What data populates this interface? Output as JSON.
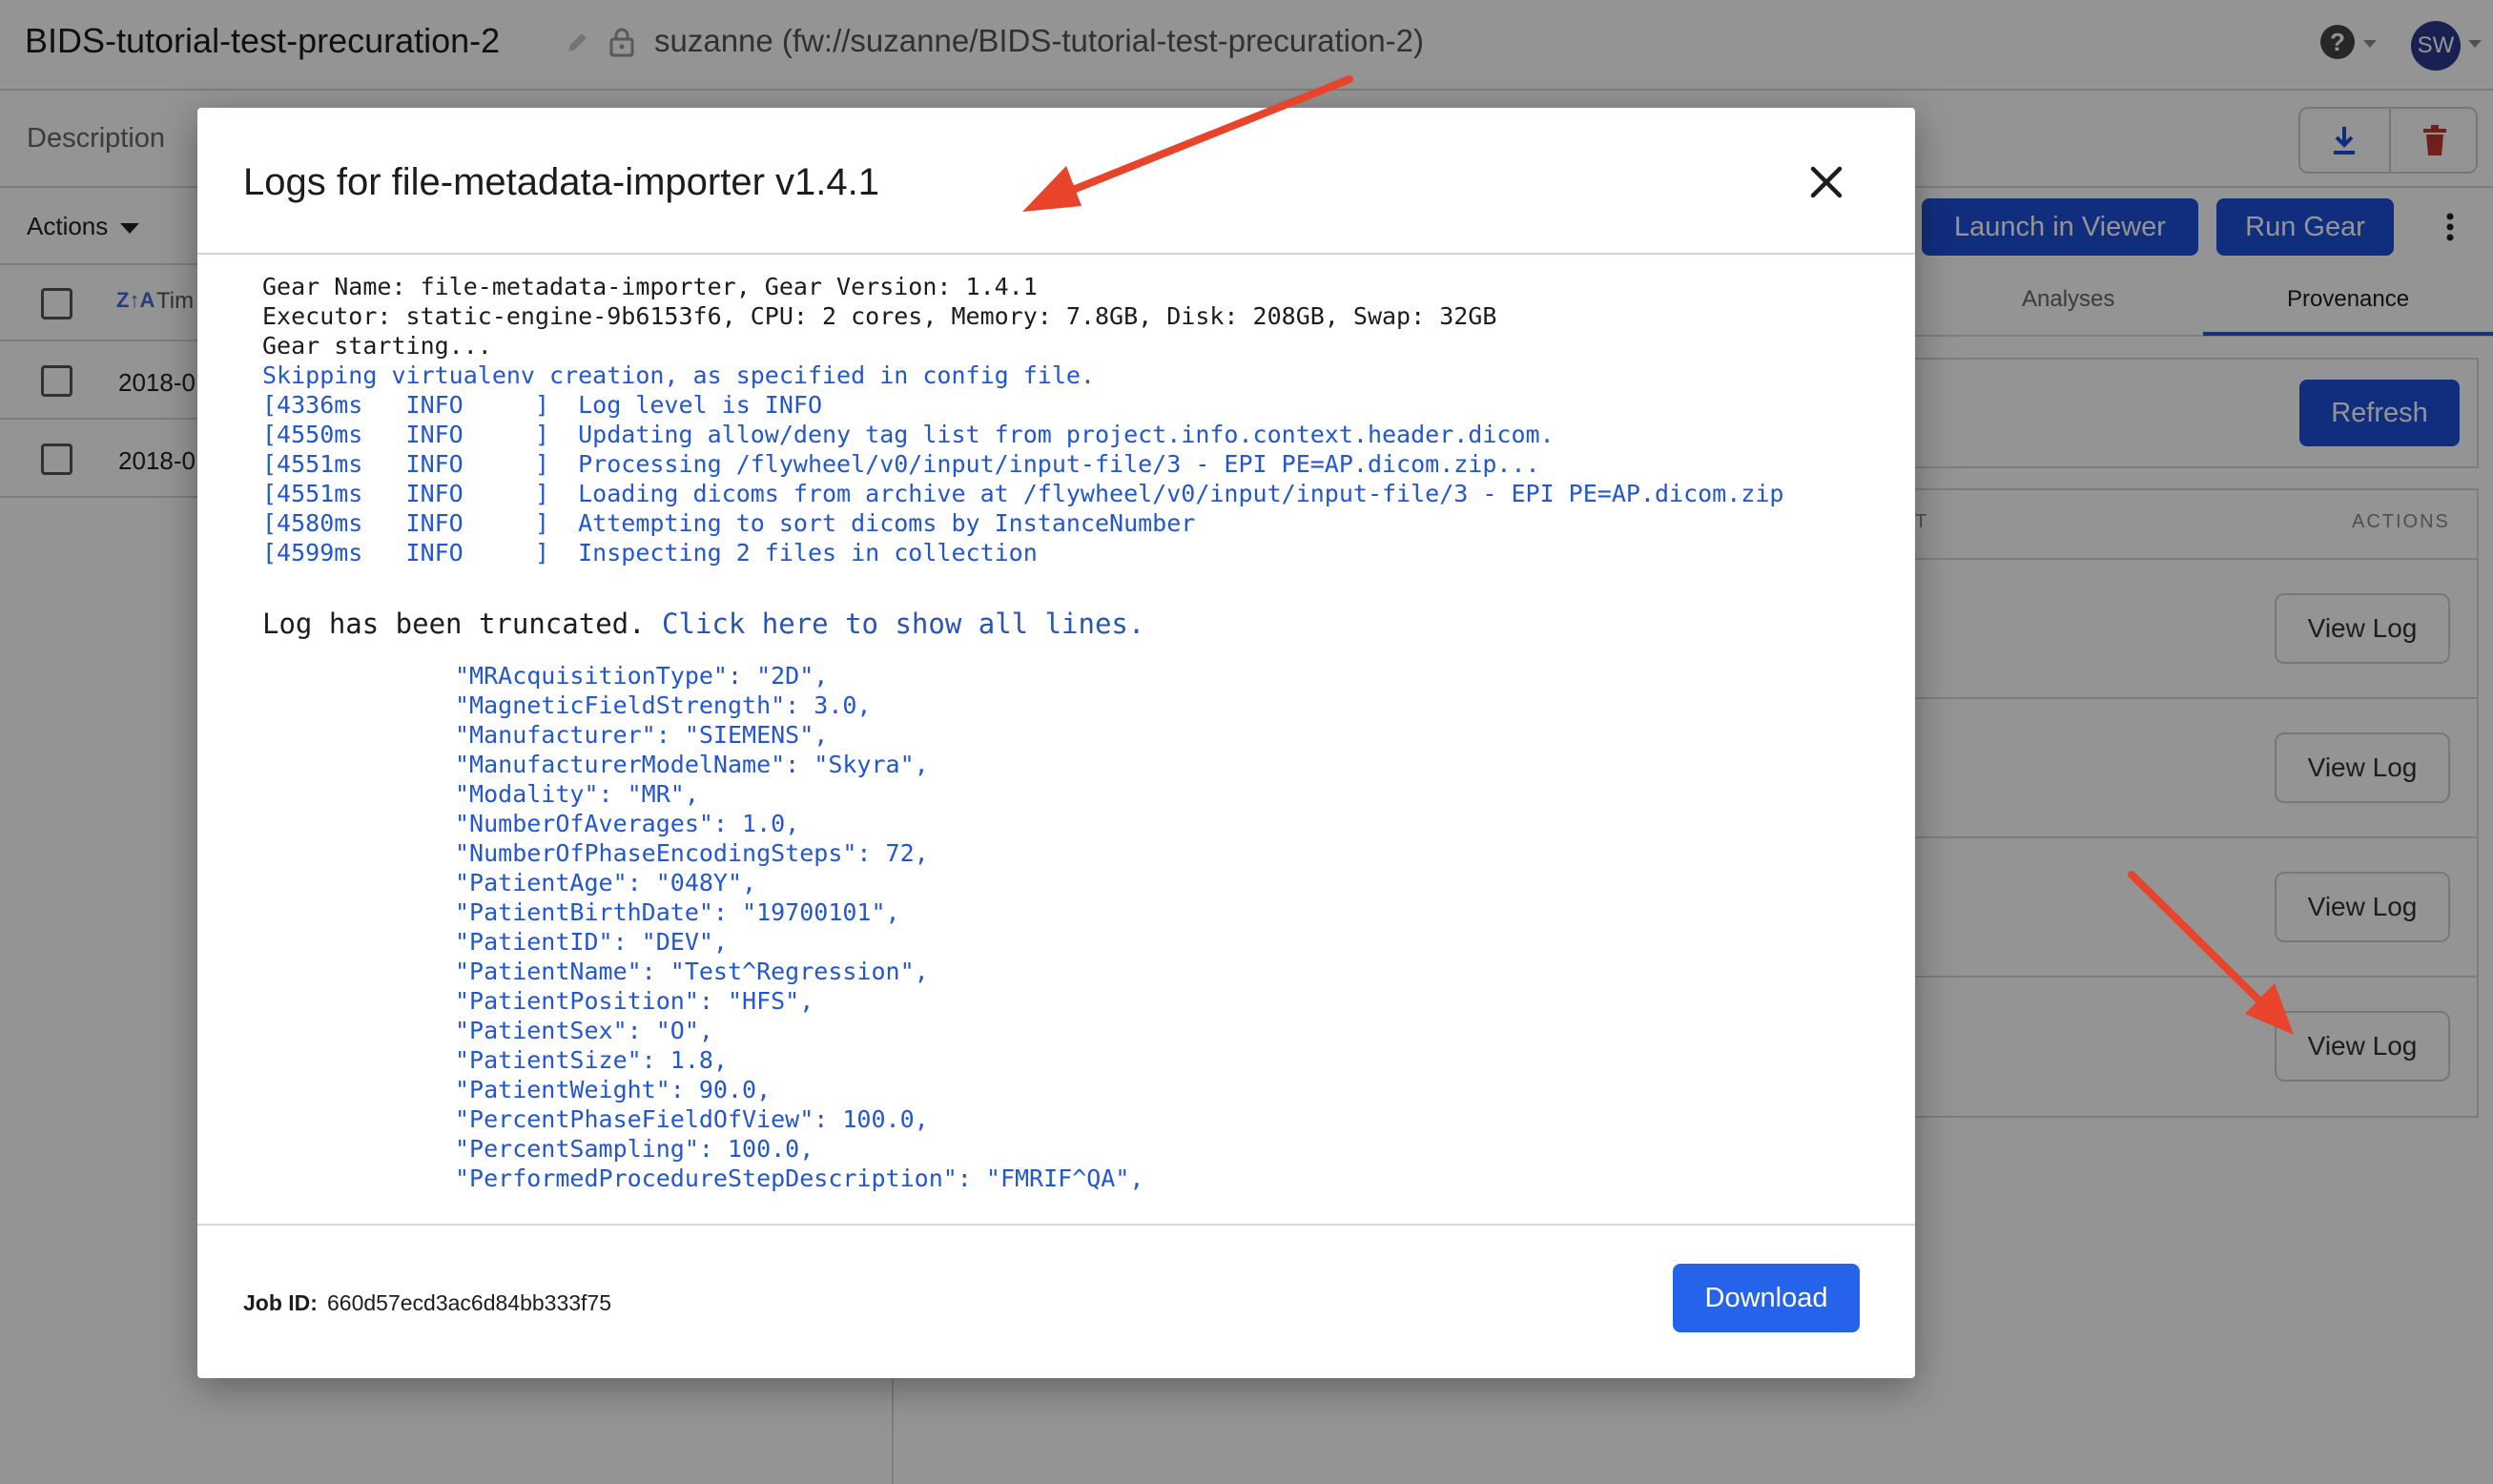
{
  "header": {
    "project_title": "BIDS-tutorial-test-precuration-2",
    "project_path": "suzanne (fw://suzanne/BIDS-tutorial-test-precuration-2)",
    "help_label": "?",
    "avatar_initials": "SW"
  },
  "description": {
    "label": "Description"
  },
  "actions": {
    "label": "Actions"
  },
  "file_list": {
    "time_column": "Tim",
    "rows": [
      {
        "date": "2018-0"
      },
      {
        "date": "2018-0"
      }
    ]
  },
  "toolbar": {
    "launch_label": "Launch in Viewer",
    "run_label": "Run Gear"
  },
  "tabs": [
    {
      "label": "Analyses"
    },
    {
      "label": "Provenance",
      "active": true
    }
  ],
  "provenance": {
    "refresh_label": "Refresh",
    "column_t": "T",
    "column_actions": "ACTIONS",
    "view_log_label": "View Log"
  },
  "modal": {
    "title": "Logs for file-metadata-importer v1.4.1",
    "log_lines": [
      {
        "text": "Gear Name: file-metadata-importer, Gear Version: 1.4.1",
        "kind": "plain"
      },
      {
        "text": "Executor: static-engine-9b6153f6, CPU: 2 cores, Memory: 7.8GB, Disk: 208GB, Swap: 32GB",
        "kind": "plain"
      },
      {
        "text": "Gear starting...",
        "kind": "plain"
      },
      {
        "text": "Skipping virtualenv creation, as specified in config file.",
        "kind": "info"
      },
      {
        "text": "[4336ms   INFO     ]  Log level is INFO",
        "kind": "info"
      },
      {
        "text": "[4550ms   INFO     ]  Updating allow/deny tag list from project.info.context.header.dicom.",
        "kind": "info"
      },
      {
        "text": "[4551ms   INFO     ]  Processing /flywheel/v0/input/input-file/3 - EPI PE=AP.dicom.zip...",
        "kind": "info"
      },
      {
        "text": "[4551ms   INFO     ]  Loading dicoms from archive at /flywheel/v0/input/input-file/3 - EPI PE=AP.dicom.zip",
        "kind": "info"
      },
      {
        "text": "[4580ms   INFO     ]  Attempting to sort dicoms by InstanceNumber",
        "kind": "info"
      },
      {
        "text": "[4599ms   INFO     ]  Inspecting 2 files in collection",
        "kind": "info"
      }
    ],
    "truncated_text": "Log has been truncated. ",
    "show_all_link": "Click here to show all lines.",
    "json_lines": [
      "\"MRAcquisitionType\": \"2D\",",
      "\"MagneticFieldStrength\": 3.0,",
      "\"Manufacturer\": \"SIEMENS\",",
      "\"ManufacturerModelName\": \"Skyra\",",
      "\"Modality\": \"MR\",",
      "\"NumberOfAverages\": 1.0,",
      "\"NumberOfPhaseEncodingSteps\": 72,",
      "\"PatientAge\": \"048Y\",",
      "\"PatientBirthDate\": \"19700101\",",
      "\"PatientID\": \"DEV\",",
      "\"PatientName\": \"Test^Regression\",",
      "\"PatientPosition\": \"HFS\",",
      "\"PatientSex\": \"O\",",
      "\"PatientSize\": 1.8,",
      "\"PatientWeight\": 90.0,",
      "\"PercentPhaseFieldOfView\": 100.0,",
      "\"PercentSampling\": 100.0,",
      "\"PerformedProcedureStepDescription\": \"FMRIF^QA\","
    ],
    "job_id_label": "Job ID:",
    "job_id": "660d57ecd3ac6d84bb333f75",
    "download_label": "Download"
  },
  "colors": {
    "primary": "#1e4ed8",
    "log_info": "#2256d2",
    "annotation_arrow": "#e8432b"
  }
}
